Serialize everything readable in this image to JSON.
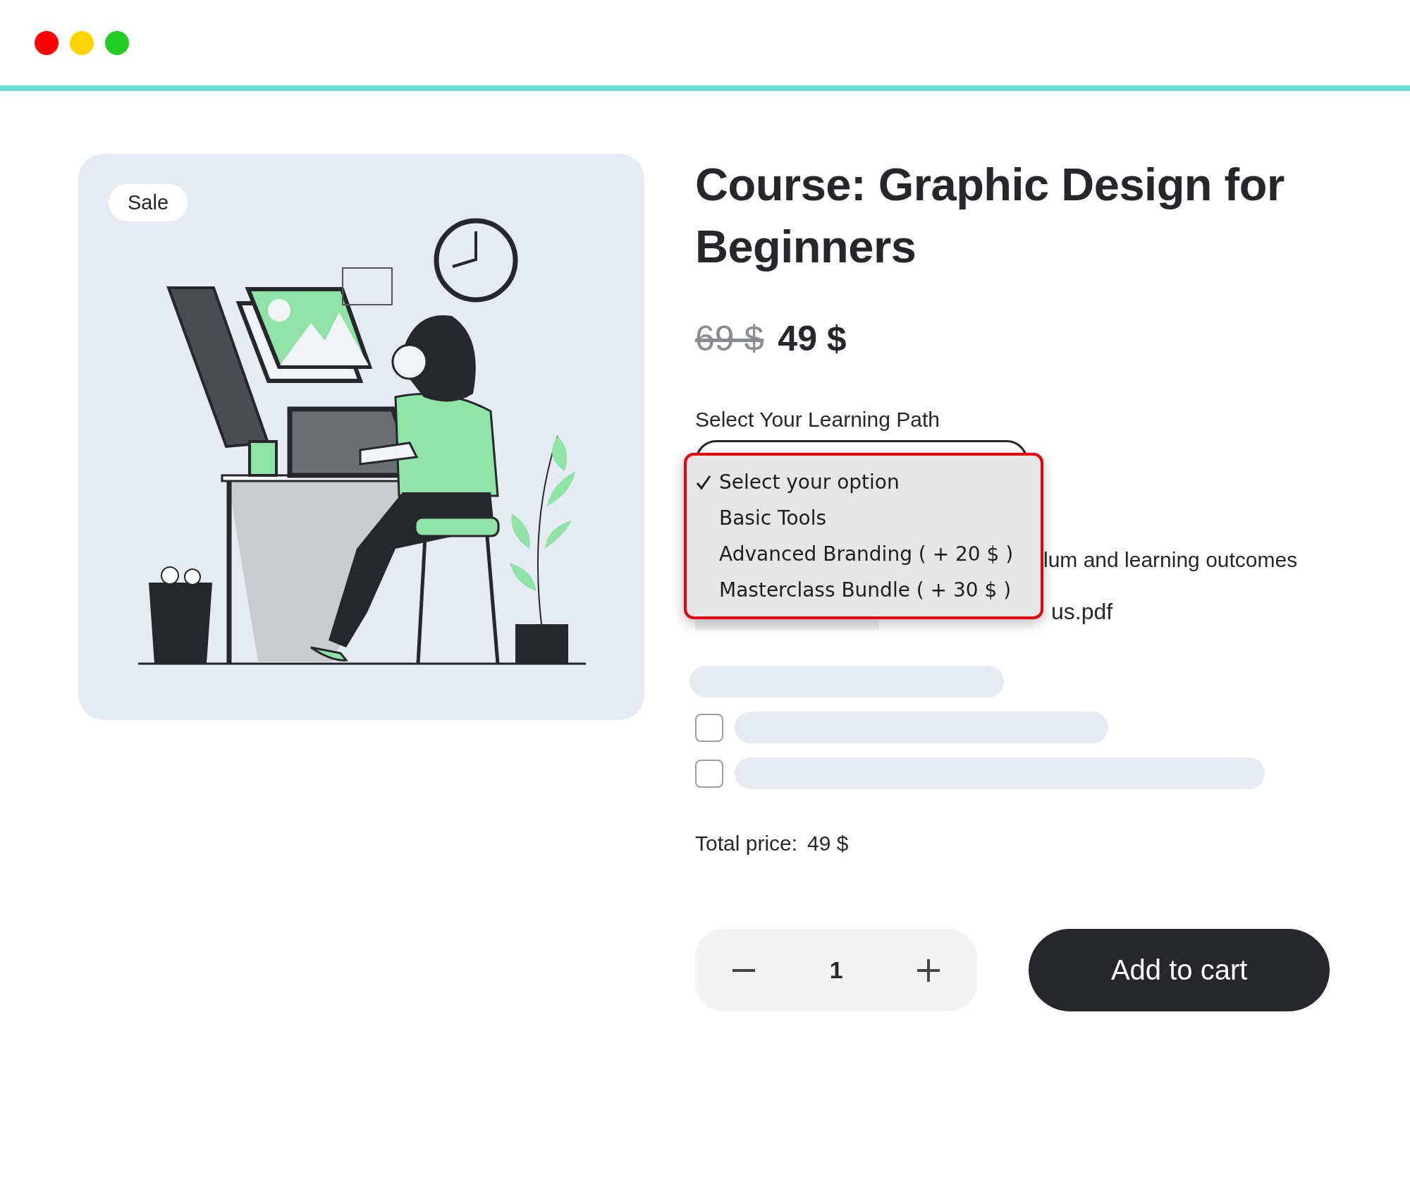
{
  "window": {
    "controls": [
      {
        "color": "#ff0000"
      },
      {
        "color": "#ffd400"
      },
      {
        "color": "#22cc22"
      }
    ]
  },
  "product": {
    "badge": "Sale",
    "title": "Course: Graphic Design for Beginners",
    "old_price": "69 $",
    "price": "49 $",
    "option_label": "Select Your Learning Path",
    "dropdown": {
      "expanded": true,
      "options": [
        {
          "label": "Select your option",
          "selected": true
        },
        {
          "label": "Basic Tools",
          "selected": false
        },
        {
          "label": "Advanced Branding ( + 20 $ )",
          "selected": false
        },
        {
          "label": "Masterclass Bundle ( + 30 $ )",
          "selected": false
        }
      ]
    },
    "description_tail": "lum and learning outcomes",
    "file_name_tail": "us.pdf",
    "placeholders": [
      {
        "kind": "bar"
      },
      {
        "kind": "checkbox_row",
        "checked": false
      },
      {
        "kind": "checkbox_row",
        "checked": false
      }
    ],
    "total_label": "Total price:",
    "total_value": "49 $",
    "quantity": "1",
    "cart_button": "Add to cart"
  }
}
